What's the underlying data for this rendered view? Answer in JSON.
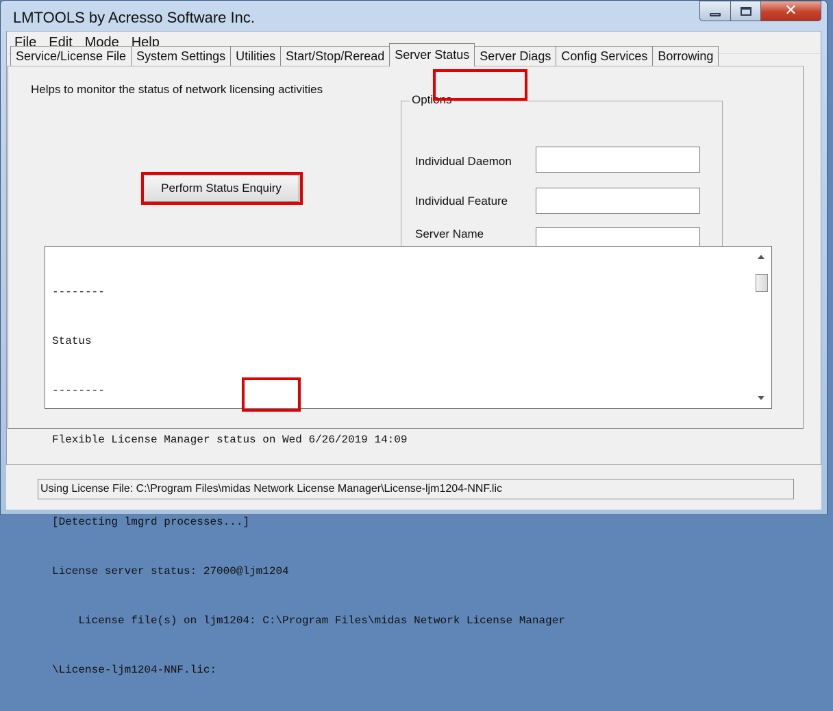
{
  "window": {
    "title": "LMTOOLS by Acresso Software Inc."
  },
  "menu": [
    "File",
    "Edit",
    "Mode",
    "Help"
  ],
  "tabs": [
    {
      "label": "Service/License File",
      "active": false
    },
    {
      "label": "System Settings",
      "active": false
    },
    {
      "label": "Utilities",
      "active": false
    },
    {
      "label": "Start/Stop/Reread",
      "active": false
    },
    {
      "label": "Server Status",
      "active": true
    },
    {
      "label": "Server Diags",
      "active": false
    },
    {
      "label": "Config Services",
      "active": false
    },
    {
      "label": "Borrowing",
      "active": false
    }
  ],
  "panel": {
    "description": "Helps to monitor the status of network licensing activities",
    "perform_button": "Perform Status Enquiry"
  },
  "options": {
    "legend": "Options",
    "individual_daemon_label": "Individual Daemon",
    "individual_daemon_value": "",
    "individual_feature_label": "Individual Feature",
    "individual_feature_value": "",
    "server_name_label": "Server Name",
    "server_name_value": ""
  },
  "log": {
    "lines": [
      "--------",
      "Status",
      "--------",
      "Flexible License Manager status on Wed 6/26/2019 14:09",
      "",
      "[Detecting lmgrd processes...]",
      "License server status: 27000@ljm1204",
      "    License file(s) on ljm1204: C:\\Program Files\\midas Network License Manager",
      "\\License-ljm1204-NNF.lic:"
    ]
  },
  "status_bar": {
    "text": "Using License File:  C:\\Program Files\\midas Network License Manager\\License-ljm1204-NNF.lic"
  },
  "colors": {
    "highlight": "#e00000",
    "title_bar": "#b9cfe8",
    "close_button": "#c5432c"
  }
}
